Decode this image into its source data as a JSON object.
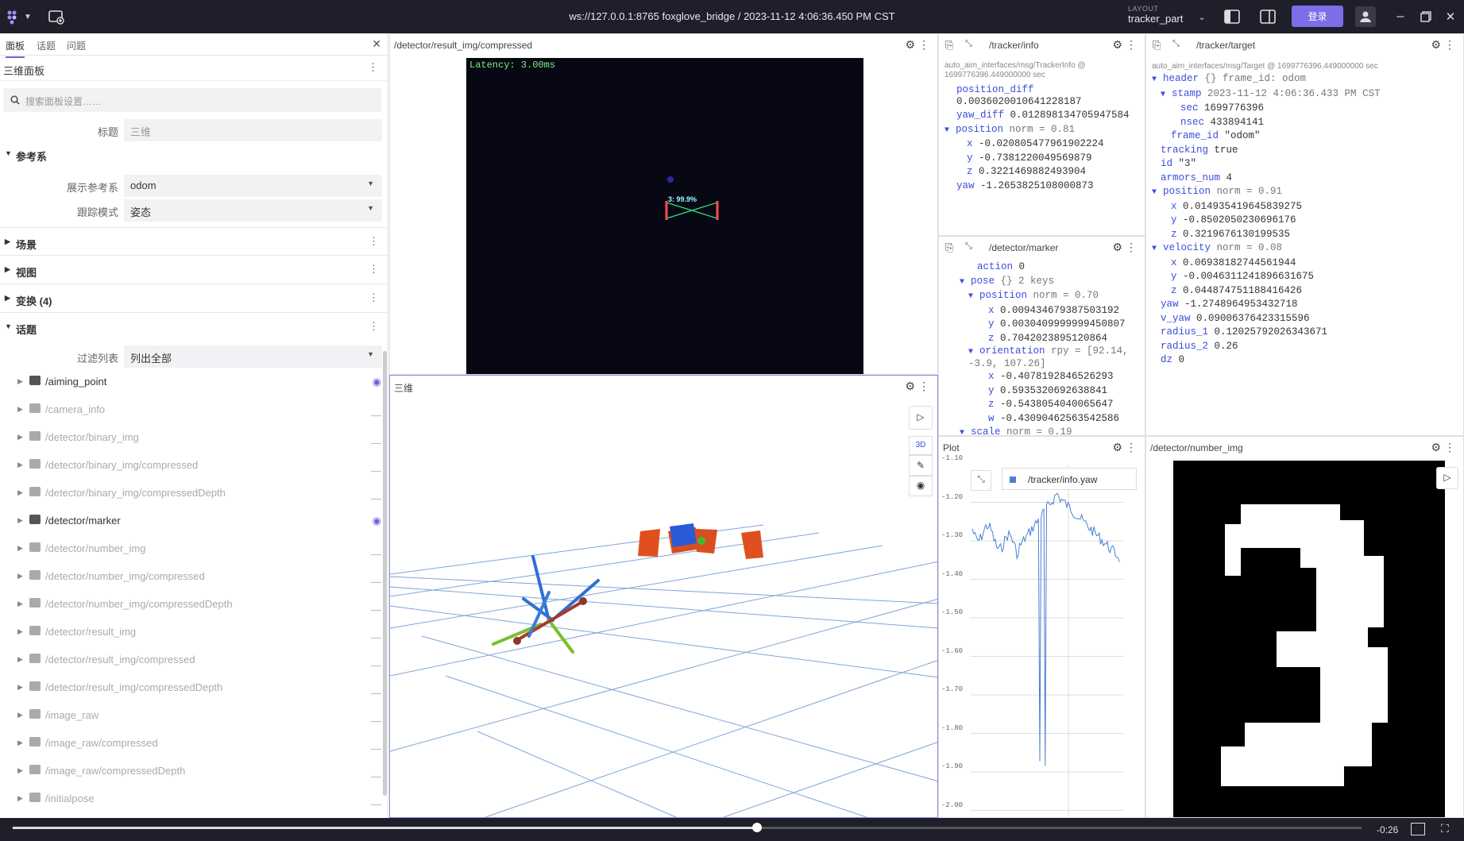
{
  "topbar": {
    "title": "ws://127.0.0.1:8765 foxglove_bridge / 2023-11-12 4:06:36.450 PM CST",
    "layout_label": "LAYOUT",
    "layout_value": "tracker_part",
    "login": "登录"
  },
  "left": {
    "tabs": [
      "面板",
      "话题",
      "问题"
    ],
    "panel_title": "三维面板",
    "search_placeholder": "搜索面板设置……",
    "title_label": "标题",
    "title_value": "三维",
    "frame_section": "参考系",
    "display_frame_label": "展示参考系",
    "display_frame_value": "odom",
    "follow_mode_label": "跟踪模式",
    "follow_mode_value": "姿态",
    "sections": [
      "场景",
      "视图",
      "变换 (4)",
      "话题"
    ],
    "filter_label": "过滤列表",
    "filter_value": "列出全部",
    "topics": [
      {
        "name": "/aiming_point",
        "visible": true
      },
      {
        "name": "/camera_info",
        "visible": false
      },
      {
        "name": "/detector/binary_img",
        "visible": false
      },
      {
        "name": "/detector/binary_img/compressed",
        "visible": false
      },
      {
        "name": "/detector/binary_img/compressedDepth",
        "visible": false
      },
      {
        "name": "/detector/marker",
        "visible": true
      },
      {
        "name": "/detector/number_img",
        "visible": false
      },
      {
        "name": "/detector/number_img/compressed",
        "visible": false
      },
      {
        "name": "/detector/number_img/compressedDepth",
        "visible": false
      },
      {
        "name": "/detector/result_img",
        "visible": false
      },
      {
        "name": "/detector/result_img/compressed",
        "visible": false
      },
      {
        "name": "/detector/result_img/compressedDepth",
        "visible": false
      },
      {
        "name": "/image_raw",
        "visible": false
      },
      {
        "name": "/image_raw/compressed",
        "visible": false
      },
      {
        "name": "/image_raw/compressedDepth",
        "visible": false
      },
      {
        "name": "/initialpose",
        "visible": false
      }
    ]
  },
  "image_panel": {
    "title": "/detector/result_img/compressed",
    "latency": "Latency: 3.00ms",
    "detection_label": "3: 99.9%"
  },
  "three_panel": {
    "title": "三维",
    "mode_3d": "3D"
  },
  "tracker_info": {
    "title": "/tracker/info",
    "meta": "auto_aim_interfaces/msg/TrackerInfo @ 1699776396.449000000 sec",
    "position_diff_key": "position_diff",
    "position_diff": "0.0036020010641228187",
    "yaw_diff_key": "yaw_diff",
    "yaw_diff": "0.012898134705947584",
    "position_key": "position",
    "position_norm": "norm = 0.81",
    "x": "-0.020805477961902224",
    "y": "-0.7381220049569879",
    "z": "0.3221469882493904",
    "yaw_key": "yaw",
    "yaw": "-1.2653825108000873"
  },
  "marker": {
    "title": "/detector/marker",
    "action": "0",
    "pose_keys": "{} 2 keys",
    "position_norm": "norm = 0.70",
    "px": "0.009434679387503192",
    "py": "0.0030409999999450807",
    "pz": "0.7042023895120864",
    "orientation_rpy": "rpy = [92.14, -3.9, 107.26]",
    "ox": "-0.4078192846526293",
    "oy": "0.5935320692638841",
    "oz": "-0.5438054040065647",
    "ow": "-0.43090462563542586",
    "scale_norm": "norm = 0.19"
  },
  "target": {
    "title": "/tracker/target",
    "meta": "auto_aim_interfaces/msg/Target @ 1699776396.449000000 sec",
    "header_meta": "{} frame_id: odom",
    "stamp": "2023-11-12 4:06:36.433 PM CST",
    "sec": "1699776396",
    "nsec": "433894141",
    "frame_id": "\"odom\"",
    "tracking": "true",
    "id": "\"3\"",
    "armors_num": "4",
    "position_norm": "norm = 0.91",
    "px": "0.014935419645839275",
    "py": "-0.8502050230696176",
    "pz": "0.3219676130199535",
    "velocity_norm": "norm = 0.08",
    "vx": "0.06938182744561944",
    "vy": "-0.0046311241896631675",
    "vz": "0.044874751188416426",
    "yaw": "-1.2748964953432718",
    "v_yaw": "0.09006376423315596",
    "radius_1": "0.12025792026343671",
    "radius_2": "0.26",
    "dz": "0"
  },
  "plot": {
    "title": "Plot",
    "legend": "/tracker/info.yaw",
    "yticks": [
      "-1.10",
      "-1.20",
      "-1.30",
      "-1.40",
      "-1.50",
      "-1.60",
      "-1.70",
      "-1.80",
      "-1.90",
      "-2.00"
    ]
  },
  "number_panel": {
    "title": "/detector/number_img"
  },
  "bottom": {
    "time_left": "-0:26",
    "progress": 0.552
  }
}
